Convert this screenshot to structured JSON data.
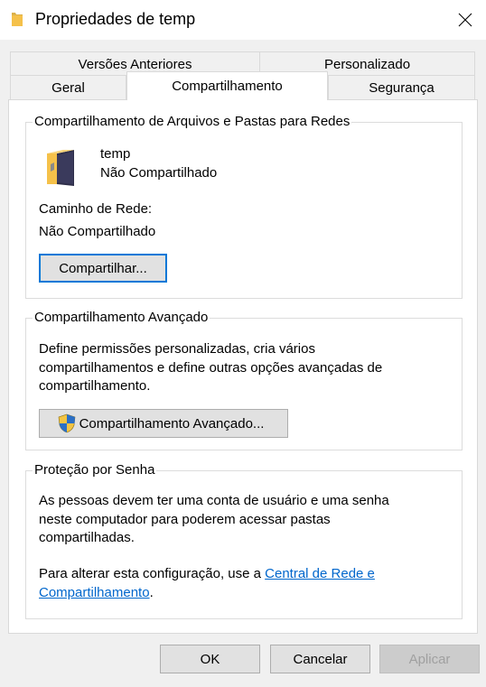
{
  "window": {
    "title": "Propriedades de temp"
  },
  "tabs": {
    "row_back": [
      "Versões Anteriores",
      "Personalizado"
    ],
    "row_front": [
      "Geral",
      "Compartilhamento",
      "Segurança"
    ],
    "active": "Compartilhamento"
  },
  "network_sharing": {
    "group_title": "Compartilhamento de Arquivos e Pastas para Redes",
    "folder_name": "temp",
    "status": "Não Compartilhado",
    "path_label": "Caminho de Rede:",
    "path_value": "Não Compartilhado",
    "share_button": "Compartilhar..."
  },
  "advanced_sharing": {
    "group_title": "Compartilhamento Avançado",
    "description": "Define permissões personalizadas, cria vários compartilhamentos e define outras opções avançadas de compartilhamento.",
    "button": "Compartilhamento Avançado..."
  },
  "password_protection": {
    "group_title": "Proteção por Senha",
    "description": "As pessoas devem ter uma conta de usuário e uma senha neste computador para poderem acessar pastas compartilhadas.",
    "change_prefix": "Para alterar esta configuração, use a ",
    "link_text": "Central de Rede e Compartilhamento",
    "change_suffix": "."
  },
  "footer": {
    "ok": "OK",
    "cancel": "Cancelar",
    "apply": "Aplicar"
  },
  "colors": {
    "accent": "#0078d7",
    "link": "#0066cc",
    "folder": "#f5c14a"
  },
  "icons": [
    "folder-icon",
    "close-icon",
    "shield-icon"
  ]
}
